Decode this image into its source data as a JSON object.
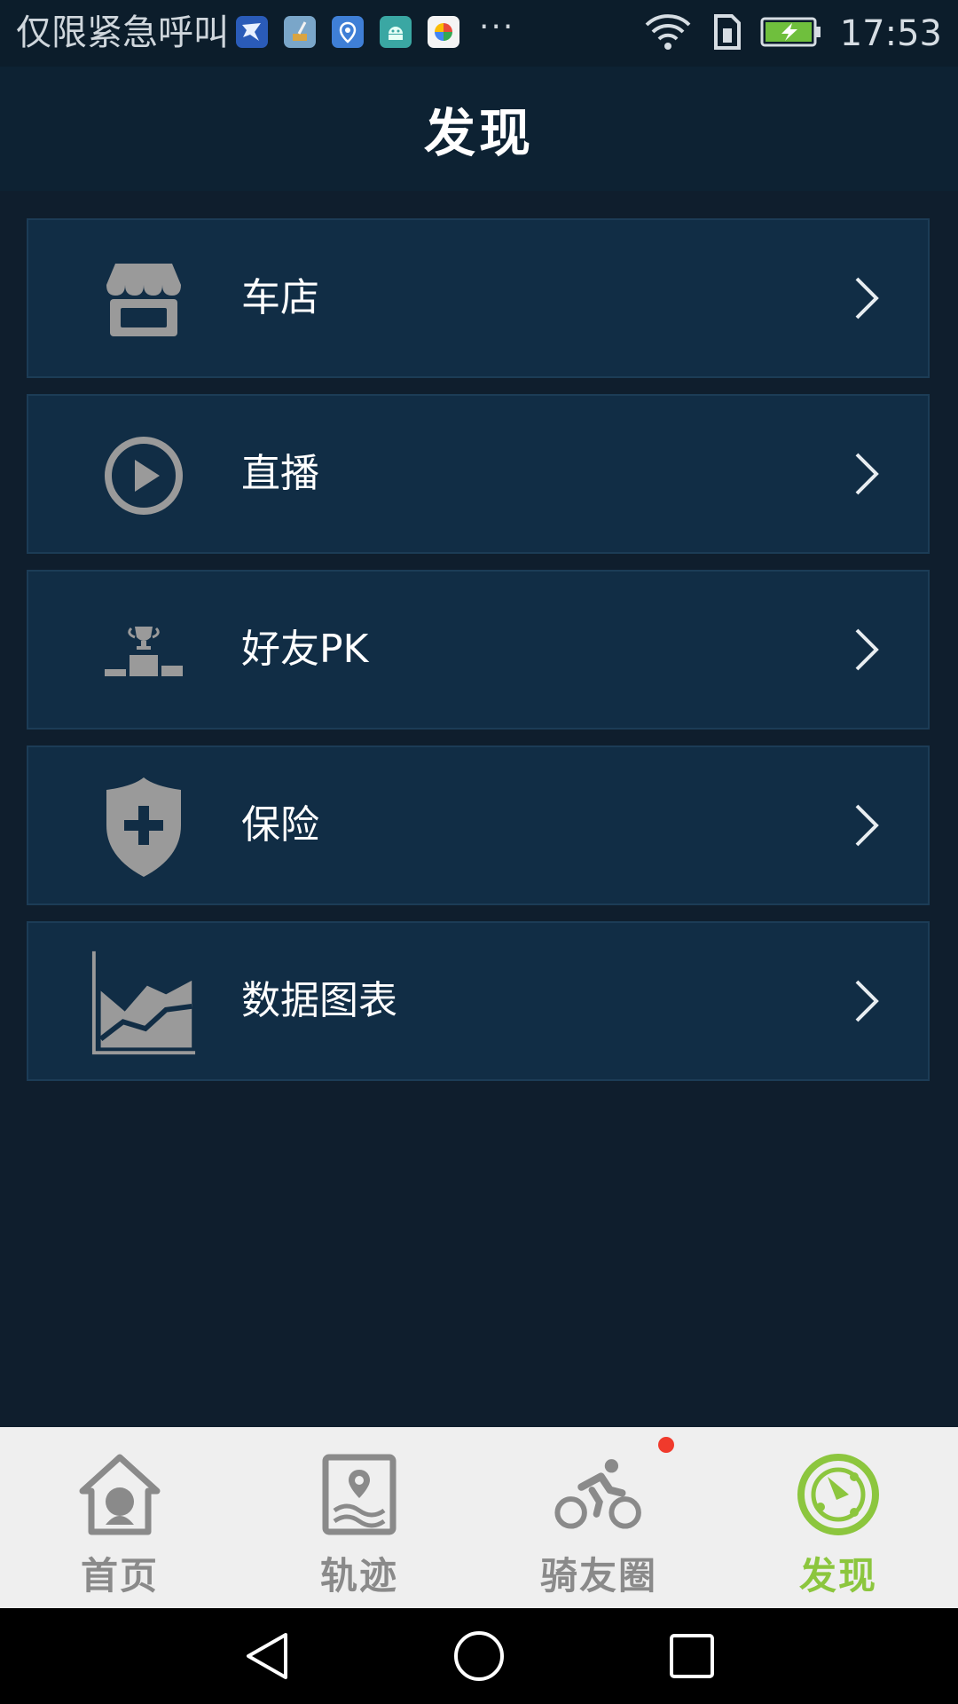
{
  "status_bar": {
    "carrier_text": "仅限紧急呼叫",
    "more_notifications": "···",
    "time": "17:53",
    "icons": [
      "bird-app-icon",
      "broom-app-icon",
      "location-app-icon",
      "android-app-icon",
      "photo-app-icon",
      "wifi-icon",
      "sim-icon",
      "battery-charging-icon"
    ]
  },
  "header": {
    "title": "发现"
  },
  "menu": {
    "items": [
      {
        "label": "车店",
        "icon": "store-icon"
      },
      {
        "label": "直播",
        "icon": "play-icon"
      },
      {
        "label": "好友PK",
        "icon": "podium-trophy-icon"
      },
      {
        "label": "保险",
        "icon": "shield-plus-icon"
      },
      {
        "label": "数据图表",
        "icon": "area-chart-icon"
      }
    ]
  },
  "bottom_nav": {
    "tabs": [
      {
        "label": "首页",
        "icon": "home-icon"
      },
      {
        "label": "轨迹",
        "icon": "map-track-icon"
      },
      {
        "label": "骑友圈",
        "icon": "cyclist-icon"
      },
      {
        "label": "发现",
        "icon": "discover-icon"
      }
    ],
    "active_index": 3,
    "active_color": "#8cc63e",
    "inactive_color": "#8a8a8a",
    "badge_color": "#f03a2c"
  },
  "colors": {
    "background": "#0f1e2d",
    "card": "#112d45",
    "title_bar": "#0d2233"
  }
}
